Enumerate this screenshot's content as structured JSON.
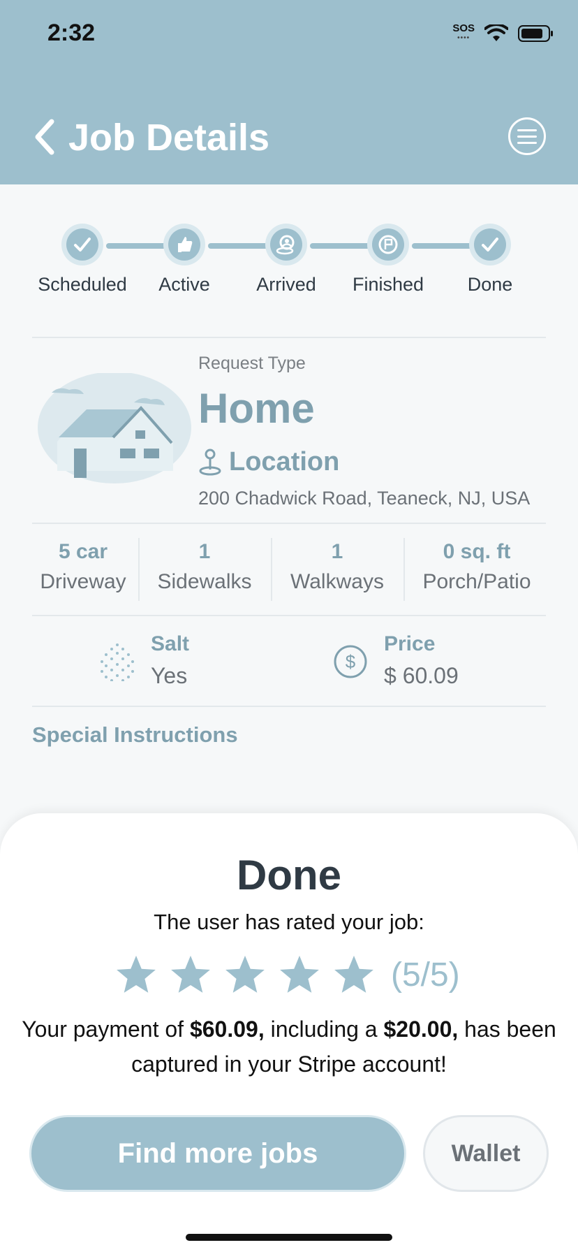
{
  "status_bar": {
    "time": "2:32",
    "sos": "SOS"
  },
  "header": {
    "title": "Job Details"
  },
  "steps": [
    {
      "label": "Scheduled",
      "icon": "check-icon"
    },
    {
      "label": "Active",
      "icon": "thumbs-up-icon"
    },
    {
      "label": "Arrived",
      "icon": "person-pin-icon"
    },
    {
      "label": "Finished",
      "icon": "flag-icon"
    },
    {
      "label": "Done",
      "icon": "check-icon"
    }
  ],
  "request": {
    "type_label": "Request Type",
    "type_value": "Home",
    "location_label": "Location",
    "address": "200 Chadwick Road, Teaneck, NJ, USA"
  },
  "stats": [
    {
      "value": "5 car",
      "label": "Driveway"
    },
    {
      "value": "1",
      "label": "Sidewalks"
    },
    {
      "value": "1",
      "label": "Walkways"
    },
    {
      "value": "0 sq. ft",
      "label": "Porch/Patio"
    }
  ],
  "salt": {
    "label": "Salt",
    "value": "Yes"
  },
  "price": {
    "label": "Price",
    "value": "$ 60.09"
  },
  "special_instructions_label": "Special Instructions",
  "sheet": {
    "title": "Done",
    "subtitle": "The user has rated your job:",
    "rating_text": "(5/5)",
    "rating_value": 5,
    "rating_max": 5,
    "payment_prefix": "Your payment of ",
    "payment_amount": "$60.09,",
    "payment_middle": " including a ",
    "payment_tip": "$20.00,",
    "payment_suffix": " has been captured in your Stripe account!"
  },
  "buttons": {
    "find_jobs": "Find more jobs",
    "wallet": "Wallet"
  },
  "colors": {
    "header": "#9dbfcd",
    "accent_text": "#7fa0ae",
    "star": "#9dbfcd"
  }
}
